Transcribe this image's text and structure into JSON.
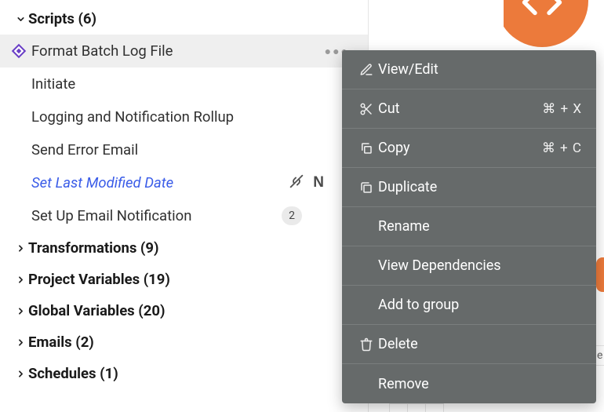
{
  "tree": {
    "scripts": {
      "label": "Scripts (6)",
      "expanded": true,
      "items": [
        {
          "label": "Format Batch Log File",
          "selected": true
        },
        {
          "label": "Initiate"
        },
        {
          "label": "Logging and Notification Rollup"
        },
        {
          "label": "Send Error Email"
        },
        {
          "label": "Set Last Modified Date",
          "unlinked": true,
          "note": "N"
        },
        {
          "label": "Set Up Email Notification",
          "count": "2"
        }
      ]
    },
    "sections": [
      {
        "label": "Transformations (9)"
      },
      {
        "label": "Project Variables (19)"
      },
      {
        "label": "Global Variables (20)"
      },
      {
        "label": "Emails (2)"
      },
      {
        "label": "Schedules (1)"
      }
    ]
  },
  "context_menu": [
    {
      "icon": "pencil",
      "label": "View/Edit"
    },
    {
      "icon": "scissors",
      "label": "Cut",
      "shortcut": "⌘ + X"
    },
    {
      "icon": "copy",
      "label": "Copy",
      "shortcut": "⌘ + C"
    },
    {
      "icon": "duplicate",
      "label": "Duplicate"
    },
    {
      "icon": "",
      "label": "Rename"
    },
    {
      "icon": "",
      "label": "View Dependencies"
    },
    {
      "icon": "",
      "label": "Add to group"
    },
    {
      "icon": "trash",
      "label": "Delete"
    },
    {
      "icon": "",
      "label": "Remove"
    }
  ],
  "bg_stub_text": "e"
}
